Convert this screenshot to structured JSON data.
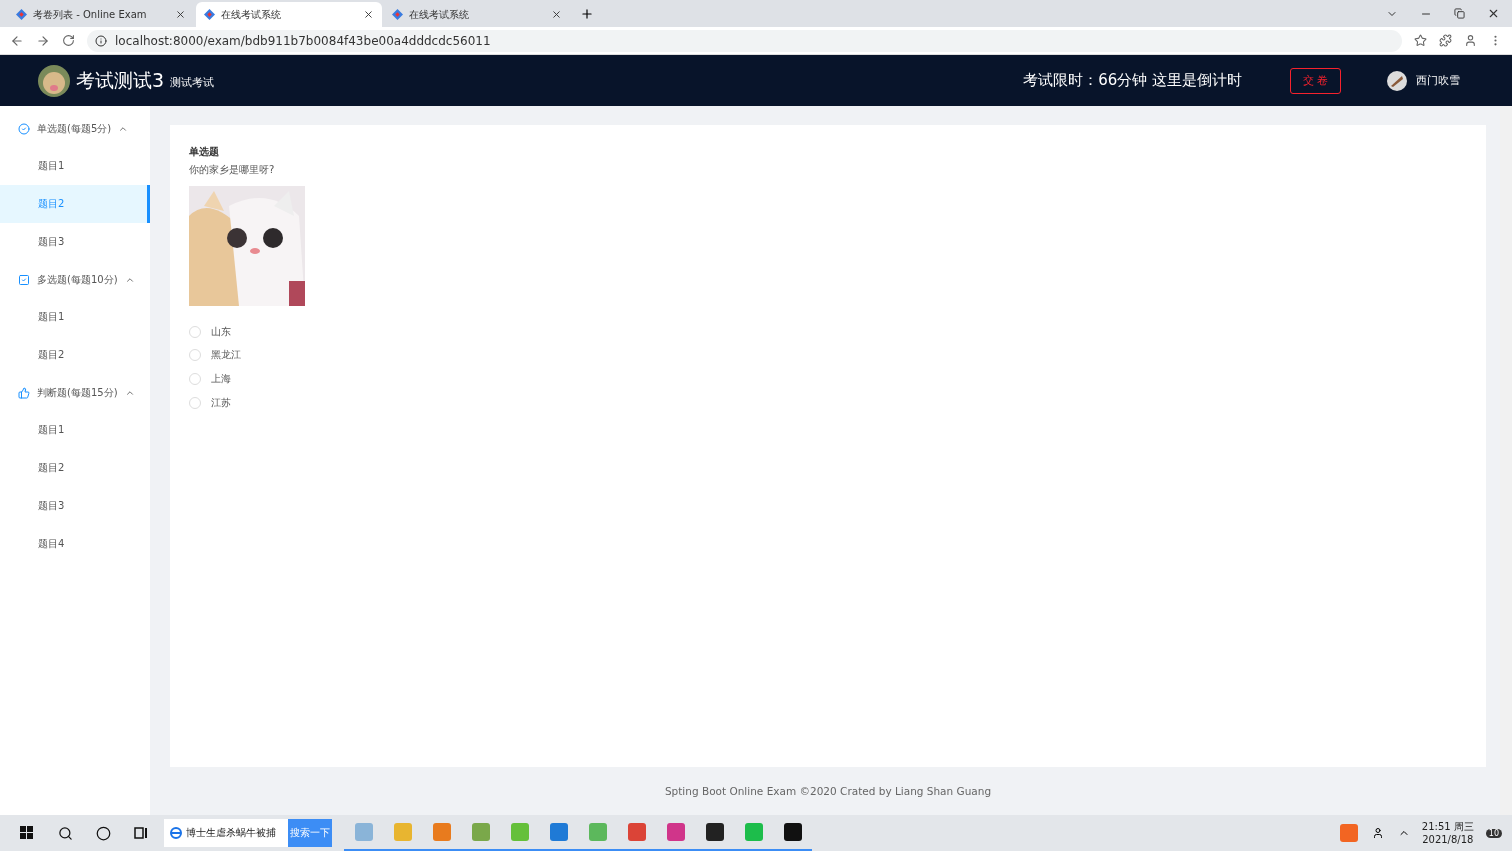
{
  "browser": {
    "tabs": [
      {
        "title": "考卷列表 - Online Exam",
        "selected": false
      },
      {
        "title": "在线考试系统",
        "selected": true
      },
      {
        "title": "在线考试系统",
        "selected": false
      }
    ],
    "address": "localhost:8000/exam/bdb911b7b0084f43be00a4dddcdc56011"
  },
  "header": {
    "title": "考试测试3",
    "subtitle": "测试考试",
    "timer": "考试限时：66分钟 这里是倒计时",
    "submit": "交 卷",
    "user": "西门吹雪"
  },
  "sidebar": {
    "groups": [
      {
        "kind": "single",
        "label": "单选题(每题5分)",
        "expanded": true,
        "items": [
          {
            "label": "题目1",
            "selected": false
          },
          {
            "label": "题目2",
            "selected": true
          },
          {
            "label": "题目3",
            "selected": false
          }
        ]
      },
      {
        "kind": "multiple",
        "label": "多选题(每题10分)",
        "expanded": true,
        "items": [
          {
            "label": "题目1",
            "selected": false
          },
          {
            "label": "题目2",
            "selected": false
          }
        ]
      },
      {
        "kind": "judge",
        "label": "判断题(每题15分)",
        "expanded": true,
        "items": [
          {
            "label": "题目1",
            "selected": false
          },
          {
            "label": "题目2",
            "selected": false
          },
          {
            "label": "题目3",
            "selected": false
          },
          {
            "label": "题目4",
            "selected": false
          }
        ]
      }
    ]
  },
  "question": {
    "type": "单选题",
    "text": "你的家乡是哪里呀?",
    "options": [
      {
        "label": "山东",
        "selected": false
      },
      {
        "label": "黑龙江",
        "selected": false
      },
      {
        "label": "上海",
        "selected": false
      },
      {
        "label": "江苏",
        "selected": false
      }
    ]
  },
  "footer": "Spting Boot Online Exam ©2020 Crated by Liang Shan Guang",
  "taskbar": {
    "search_text": "博士生虐杀蜗牛被捕",
    "search_button": "搜索一下",
    "time": "21:51 周三",
    "date": "2021/8/18",
    "badge": "10"
  }
}
